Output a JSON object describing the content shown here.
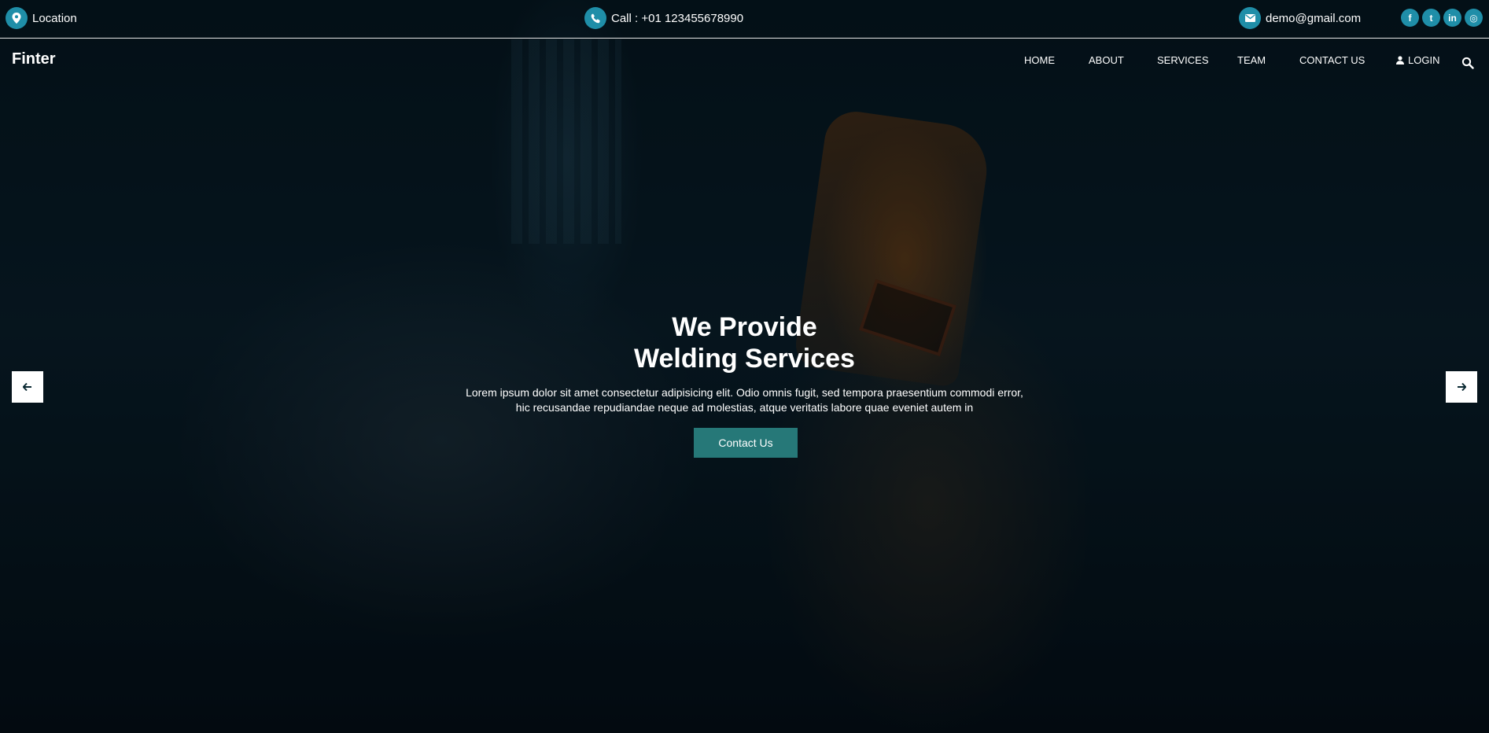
{
  "topbar": {
    "location_label": "Location",
    "phone_label": "Call : +01 123455678990",
    "email_label": "demo@gmail.com",
    "social": [
      {
        "name": "facebook-icon",
        "glyph": "f"
      },
      {
        "name": "twitter-icon",
        "glyph": "t"
      },
      {
        "name": "linkedin-icon",
        "glyph": "in"
      },
      {
        "name": "instagram-icon",
        "glyph": "◎"
      }
    ]
  },
  "nav": {
    "logo": "Finter",
    "items": [
      "HOME",
      "ABOUT",
      "SERVICES",
      "TEAM",
      "CONTACT US"
    ],
    "login_label": "LOGIN"
  },
  "hero": {
    "title_line1": "We Provide",
    "title_line2": "Welding Services",
    "description_line1": "Lorem ipsum dolor sit amet consectetur adipisicing elit. Odio omnis fugit, sed tempora praesentium commodi error,",
    "description_line2": "hic recusandae repudiandae neque ad molestias, atque veritatis labore quae eveniet autem in",
    "cta_label": "Contact Us"
  },
  "theme": {
    "accent": "#1f8ea8",
    "button": "#267878"
  }
}
